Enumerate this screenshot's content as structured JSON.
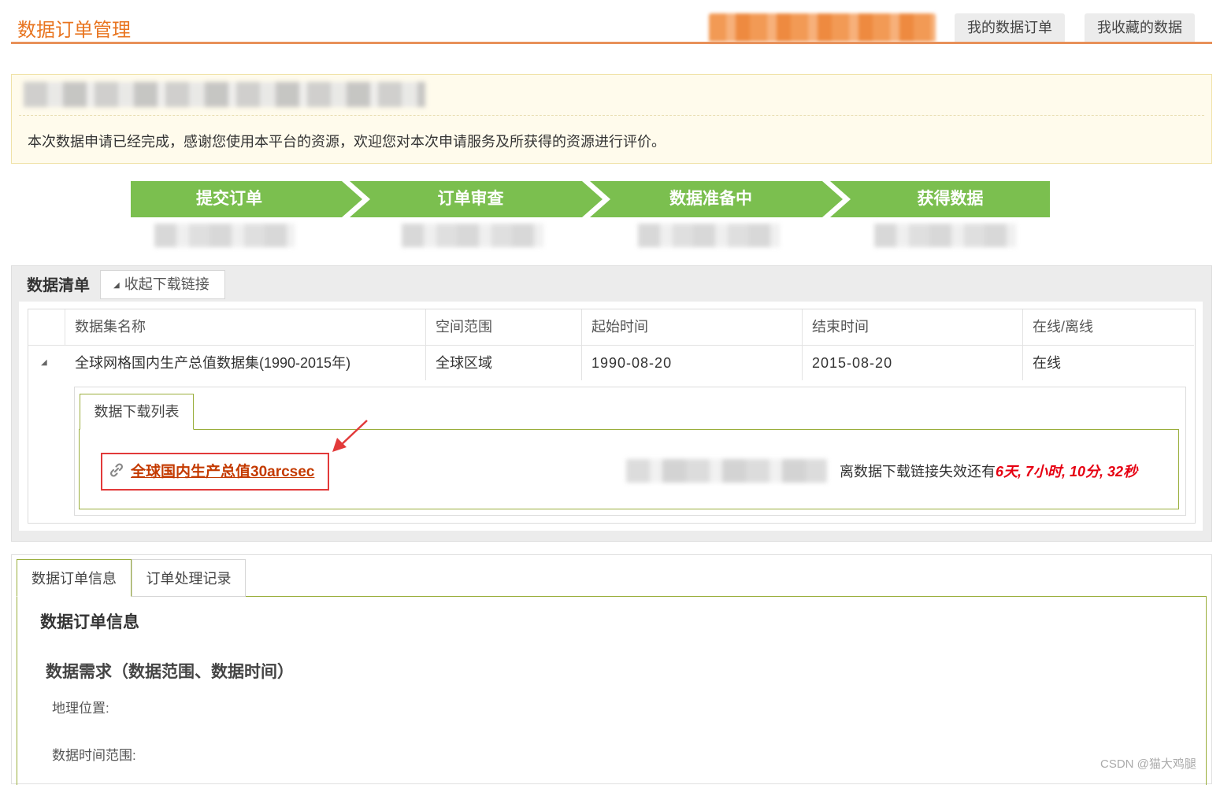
{
  "header": {
    "title": "数据订单管理",
    "tabs": [
      "我的数据订单",
      "我收藏的数据"
    ]
  },
  "notice": {
    "message": "本次数据申请已经完成，感谢您使用本平台的资源，欢迎您对本次申请服务及所获得的资源进行评价。"
  },
  "steps": [
    "提交订单",
    "订单审查",
    "数据准备中",
    "获得数据"
  ],
  "data_list": {
    "title": "数据清单",
    "collapse_label": "收起下载链接",
    "columns": [
      "数据集名称",
      "空间范围",
      "起始时间",
      "结束时间",
      "在线/离线"
    ],
    "rows": [
      {
        "name": "全球网格国内生产总值数据集(1990-2015年)",
        "spatial": "全球区域",
        "start": "1990-08-20",
        "end": "2015-08-20",
        "status": "在线"
      }
    ],
    "download": {
      "tab_label": "数据下载列表",
      "link_text": "全球国内生产总值30arcsec",
      "expire_prefix": "离数据下载链接失效还有",
      "expire_value": "6天, 7小时, 10分, 32秒"
    }
  },
  "order_tabs": [
    "数据订单信息",
    "订单处理记录"
  ],
  "order_info": {
    "title": "数据订单信息",
    "requirement_title": "数据需求（数据范围、数据时间）",
    "location_label": "地理位置:",
    "time_range_label": "数据时间范围:"
  },
  "watermark": "CSDN @猫大鸡腿",
  "colors": {
    "accent_orange": "#e8741f",
    "step_green": "#7bbf4f",
    "red_highlight": "#e23a3a",
    "link_brown": "#c43a00",
    "expire_red": "#e60012"
  }
}
